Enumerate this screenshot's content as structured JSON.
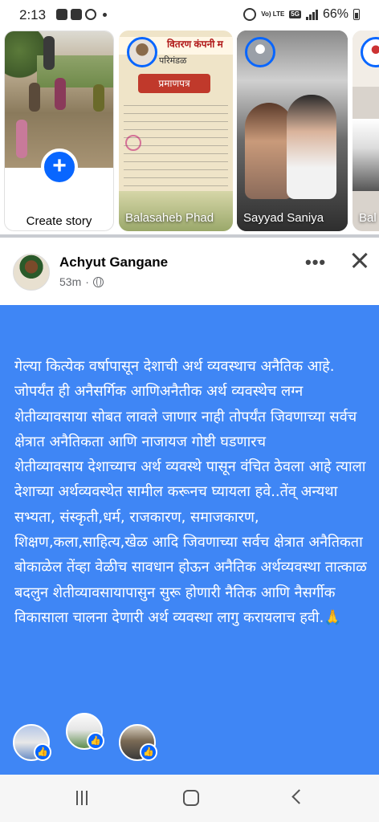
{
  "status_bar": {
    "time": "2:13",
    "volte": "Vo) LTE",
    "network": "5G",
    "battery": "66%"
  },
  "stories": {
    "create_label": "Create story",
    "items": [
      {
        "name": "Balasaheb Phad",
        "banner": "वितरण कंपनी म",
        "sub": "परिमंडळ",
        "ribbon": "प्रमाणपत्र"
      },
      {
        "name": "Sayyad Saniya"
      },
      {
        "name": "Bal"
      }
    ]
  },
  "post": {
    "author": "Achyut Gangane",
    "time": "53m",
    "background_color": "#3f86f5",
    "text": "गेल्या कित्येक वर्षापासून देशाची अर्थ व्यवस्थाच अनैतिक आहे. जोपर्यंत ही अनैसर्गिक आणिअनैतीक अर्थ व्यवस्थेच लग्न शेतीव्यावसाया सोबत लावले जाणार नाही तोपर्यंत जिवणाच्या सर्वच क्षेत्रात अनैतिकता आणि नाजायज गोष्टी घडणारच\nशेतीव्यावसाय देशाच्याच अर्थ व्यवस्थे पासून वंचित ठेवला आहे त्याला देशाच्या अर्थव्यवस्थेत सामील करूनच घ्यायला हवे..तेंव् अन्यथा सभ्यता, संस्कृती,धर्म, राजकारण, समाजकारण, शिक्षण,कला,साहित्य,खेळ आदि जिवणाच्या सर्वच क्षेत्रात अनैतिकता बोकाळेल तेंव्हा वेळीच सावधान होऊन अनैतिक अर्थव्यवस्था तात्काळ बदलुन शेतीव्यावसायापासुन सुरू होणारी नैतिक आणि नैसर्गीक विकासाला चालना  देणारी अर्थ व्यवस्था लागु करायलाच हवी.🙏"
  },
  "icons": {
    "more": "more-icon",
    "close": "close-icon",
    "globe": "globe-icon",
    "like": "like-icon"
  },
  "colors": {
    "accent": "#0866ff",
    "post_bg": "#3f86f5"
  }
}
